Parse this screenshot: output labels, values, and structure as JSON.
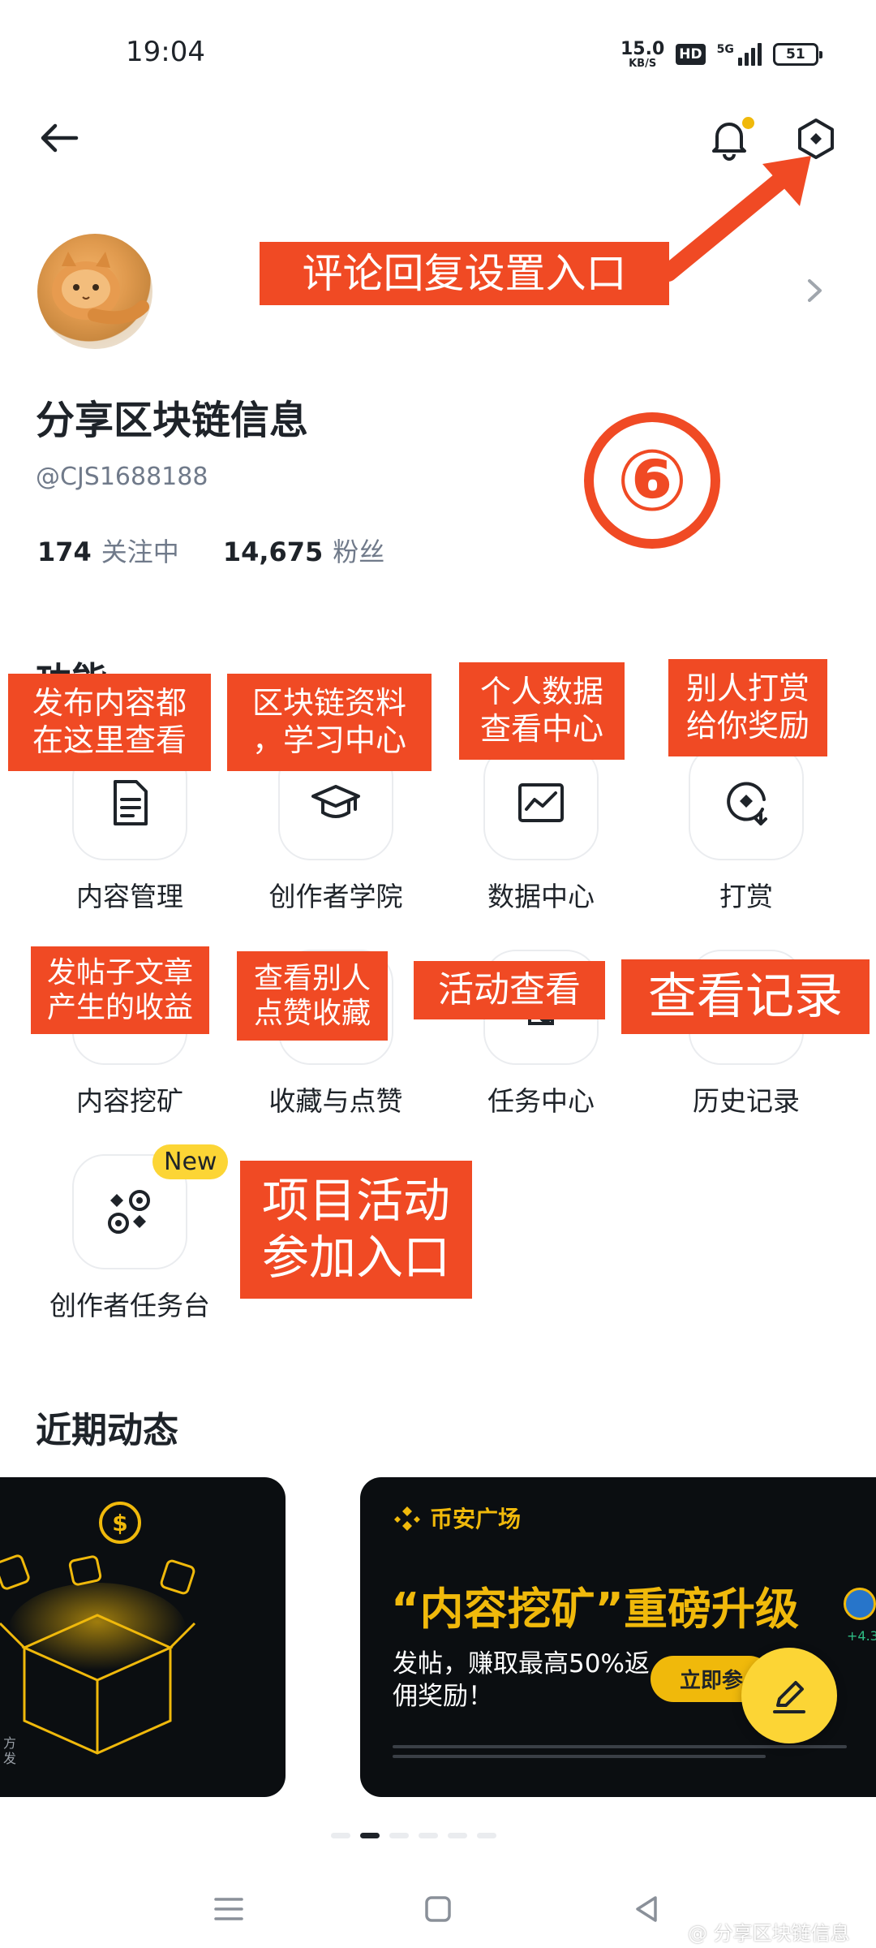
{
  "status_bar": {
    "time": "19:04",
    "net_speed": "15.0",
    "net_unit": "KB/S",
    "hd": "HD",
    "network": "5G",
    "battery": "51"
  },
  "profile": {
    "name": "分享区块链信息",
    "handle": "@CJS1688188",
    "following_count": "174",
    "following_label": "关注中",
    "followers_count": "14,675",
    "followers_label": "粉丝"
  },
  "features": {
    "title": "功能",
    "items": [
      {
        "label": "内容管理",
        "icon": "document-icon"
      },
      {
        "label": "创作者学院",
        "icon": "graduation-cap-icon"
      },
      {
        "label": "数据中心",
        "icon": "chart-icon"
      },
      {
        "label": "打赏",
        "icon": "tip-icon"
      },
      {
        "label": "内容挖矿",
        "icon": "mining-icon"
      },
      {
        "label": "收藏与点赞",
        "icon": "heart-icon"
      },
      {
        "label": "任务中心",
        "icon": "task-icon"
      },
      {
        "label": "历史记录",
        "icon": "history-icon"
      },
      {
        "label": "创作者任务台",
        "icon": "dice-icon"
      }
    ],
    "new_badge": "New"
  },
  "recent": {
    "title": "近期动态",
    "left_card_caption": "方发",
    "banner": {
      "brand": "币安广场",
      "headline": "“内容挖矿”重磅升级",
      "subtitle": "发帖，赚取最高50%返佣奖励！",
      "button": "立即参",
      "side_value": "+4.3"
    }
  },
  "annotations": {
    "settings": "评论回复设置入口",
    "step": "⑥",
    "content_mgmt": "发布内容都\n在这里查看",
    "academy": "区块链资料\n，学习中心",
    "data": "个人数据\n查看中心",
    "tip": "别人打赏\n给你奖励",
    "mining": "发帖子文章\n产生的收益",
    "favorites": "查看别人\n点赞收藏",
    "tasks": "活动查看",
    "history": "查看记录",
    "project": "项目活动\n参加入口"
  },
  "watermark": "@ 分享区块链信息",
  "colors": {
    "accent": "#f0b90b",
    "annotation": "#f04a24",
    "text_primary": "#1e2329",
    "text_secondary": "#707a8a"
  }
}
